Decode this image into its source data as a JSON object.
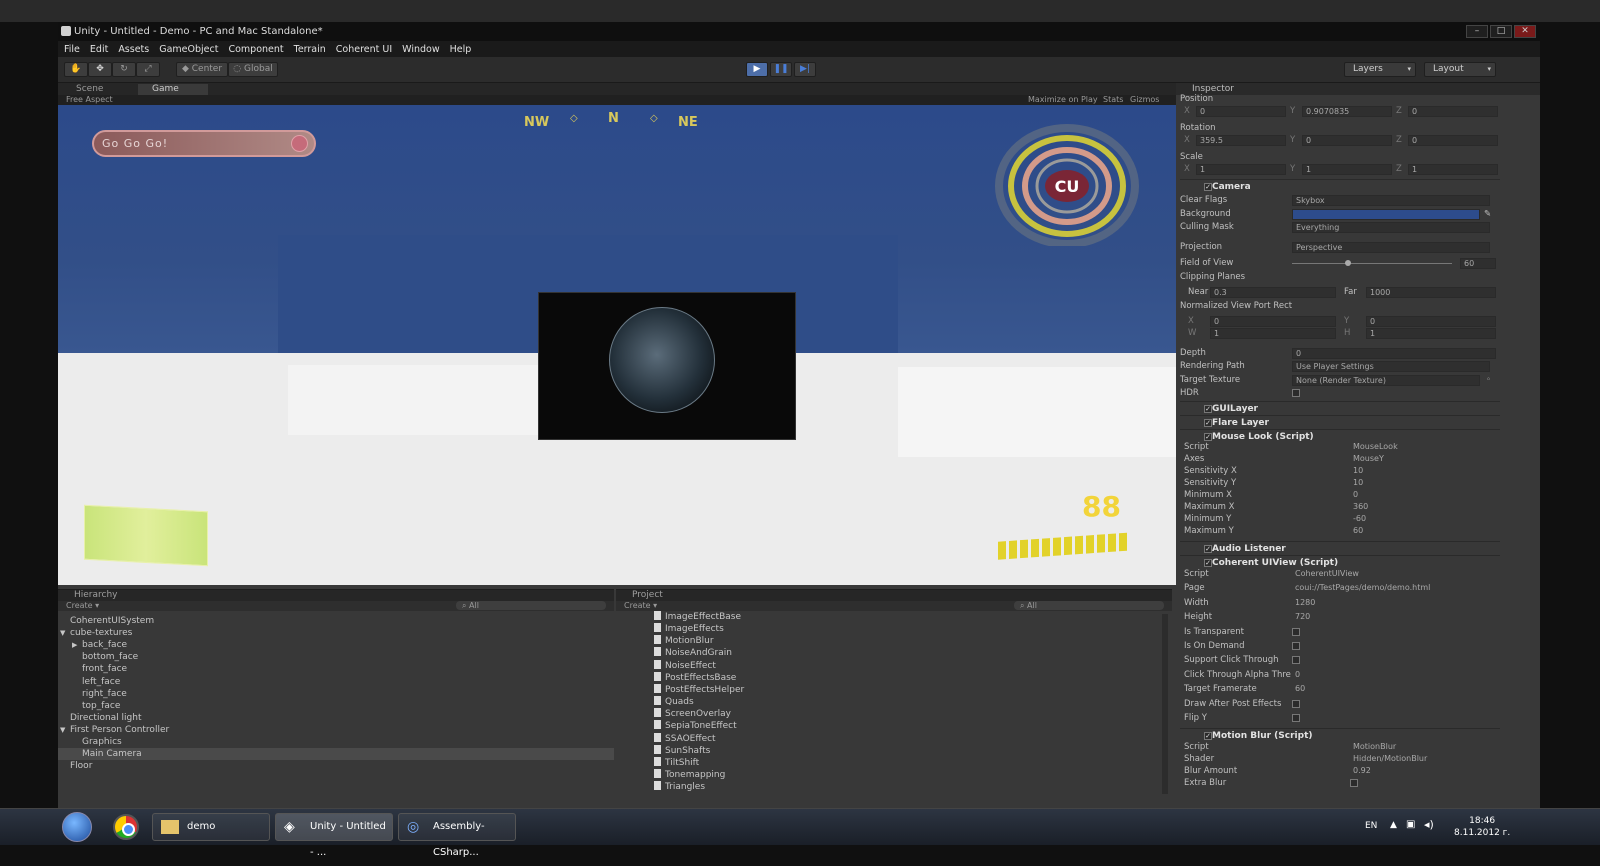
{
  "window": {
    "title": "Unity - Untitled - Demo - PC and Mac Standalone*"
  },
  "menu": [
    "File",
    "Edit",
    "Assets",
    "GameObject",
    "Component",
    "Terrain",
    "Coherent UI",
    "Window",
    "Help"
  ],
  "toolbar": {
    "center_label": "Center",
    "global_label": "Global",
    "layers_label": "Layers",
    "layout_label": "Layout"
  },
  "scene_tabs": {
    "scene": "Scene",
    "game": "Game"
  },
  "gamebar": {
    "aspect": "Free Aspect",
    "maximize": "Maximize on Play",
    "stats": "Stats",
    "gizmos": "Gizmos"
  },
  "hud": {
    "go_text": "Go Go Go!",
    "compass": [
      "NW",
      "◇",
      "N",
      "◇",
      "NE"
    ],
    "logo": "CU",
    "health_number": "88"
  },
  "inspector": {
    "tab_title": "Inspector",
    "position_label": "Position",
    "position": {
      "x": "0",
      "y": "0.9070835",
      "z": "0"
    },
    "rotation_label": "Rotation",
    "rotation": {
      "x": "359.5",
      "y": "0",
      "z": "0"
    },
    "scale_label": "Scale",
    "scale": {
      "x": "1",
      "y": "1",
      "z": "1"
    },
    "camera": {
      "name": "Camera",
      "clear_flags_label": "Clear Flags",
      "clear_flags": "Skybox",
      "background_label": "Background",
      "culling_label": "Culling Mask",
      "culling": "Everything",
      "projection_label": "Projection",
      "projection": "Perspective",
      "fov_label": "Field of View",
      "fov": "60",
      "clipping_label": "Clipping Planes",
      "near_label": "Near",
      "near": "0.3",
      "far_label": "Far",
      "far": "1000",
      "viewport_label": "Normalized View Port Rect",
      "vp_x": "0",
      "vp_y": "0",
      "vp_w": "1",
      "vp_h": "1",
      "depth_label": "Depth",
      "depth": "0",
      "rendering_path_label": "Rendering Path",
      "rendering_path": "Use Player Settings",
      "target_texture_label": "Target Texture",
      "target_texture": "None (Render Texture)",
      "hdr_label": "HDR"
    },
    "gui_layer": "GUILayer",
    "flare_layer": "Flare Layer",
    "mouse_look": {
      "name": "Mouse Look (Script)",
      "rows": [
        {
          "label": "Script",
          "value": "MouseLook"
        },
        {
          "label": "Axes",
          "value": "MouseY"
        },
        {
          "label": "Sensitivity X",
          "value": "10"
        },
        {
          "label": "Sensitivity Y",
          "value": "10"
        },
        {
          "label": "Minimum X",
          "value": "0"
        },
        {
          "label": "Maximum X",
          "value": "360"
        },
        {
          "label": "Minimum Y",
          "value": "-60"
        },
        {
          "label": "Maximum Y",
          "value": "60"
        }
      ]
    },
    "audio_listener": "Audio Listener",
    "coherent": {
      "name": "Coherent UIView (Script)",
      "rows": [
        {
          "label": "Script",
          "value": "CoherentUIView"
        },
        {
          "label": "Page",
          "value": "coui://TestPages/demo/demo.html"
        },
        {
          "label": "Width",
          "value": "1280"
        },
        {
          "label": "Height",
          "value": "720"
        },
        {
          "label": "Is Transparent",
          "value": ""
        },
        {
          "label": "Is On Demand",
          "value": ""
        },
        {
          "label": "Support Click Through",
          "value": ""
        },
        {
          "label": "Click Through Alpha Thre",
          "value": "0"
        },
        {
          "label": "Target Framerate",
          "value": "60"
        },
        {
          "label": "Draw After Post Effects",
          "value": ""
        },
        {
          "label": "Flip Y",
          "value": ""
        }
      ]
    },
    "motion_blur": {
      "name": "Motion Blur (Script)",
      "rows": [
        {
          "label": "Script",
          "value": "MotionBlur"
        },
        {
          "label": "Shader",
          "value": "Hidden/MotionBlur"
        },
        {
          "label": "Blur Amount",
          "value": "0.92"
        },
        {
          "label": "Extra Blur",
          "value": ""
        }
      ]
    }
  },
  "hierarchy": {
    "title": "Hierarchy",
    "create": "Create ▾",
    "search": "All",
    "items": [
      {
        "label": "CoherentUISystem",
        "indent": 0
      },
      {
        "label": "cube-textures",
        "indent": 0,
        "arrow": "▼"
      },
      {
        "label": "back_face",
        "indent": 1,
        "arrow": "▶"
      },
      {
        "label": "bottom_face",
        "indent": 1
      },
      {
        "label": "front_face",
        "indent": 1
      },
      {
        "label": "left_face",
        "indent": 1
      },
      {
        "label": "right_face",
        "indent": 1
      },
      {
        "label": "top_face",
        "indent": 1
      },
      {
        "label": "Directional light",
        "indent": 0
      },
      {
        "label": "First Person Controller",
        "indent": 0,
        "arrow": "▼"
      },
      {
        "label": "Graphics",
        "indent": 1
      },
      {
        "label": "Main Camera",
        "indent": 1,
        "selected": true
      },
      {
        "label": "Floor",
        "indent": 0
      }
    ]
  },
  "project": {
    "title": "Project",
    "create": "Create ▾",
    "search": "All",
    "items": [
      "ImageEffectBase",
      "ImageEffects",
      "MotionBlur",
      "NoiseAndGrain",
      "NoiseEffect",
      "PostEffectsBase",
      "PostEffectsHelper",
      "Quads",
      "ScreenOverlay",
      "SepiaToneEffect",
      "SSAOEffect",
      "SunShafts",
      "TiltShift",
      "Tonemapping",
      "Triangles"
    ]
  },
  "taskbar": {
    "demo": "demo",
    "unity": "Unity - Untitled - ...",
    "assembly": "Assembly-CSharp...",
    "lang": "EN",
    "time": "18:46",
    "date": "8.11.2012 г."
  }
}
